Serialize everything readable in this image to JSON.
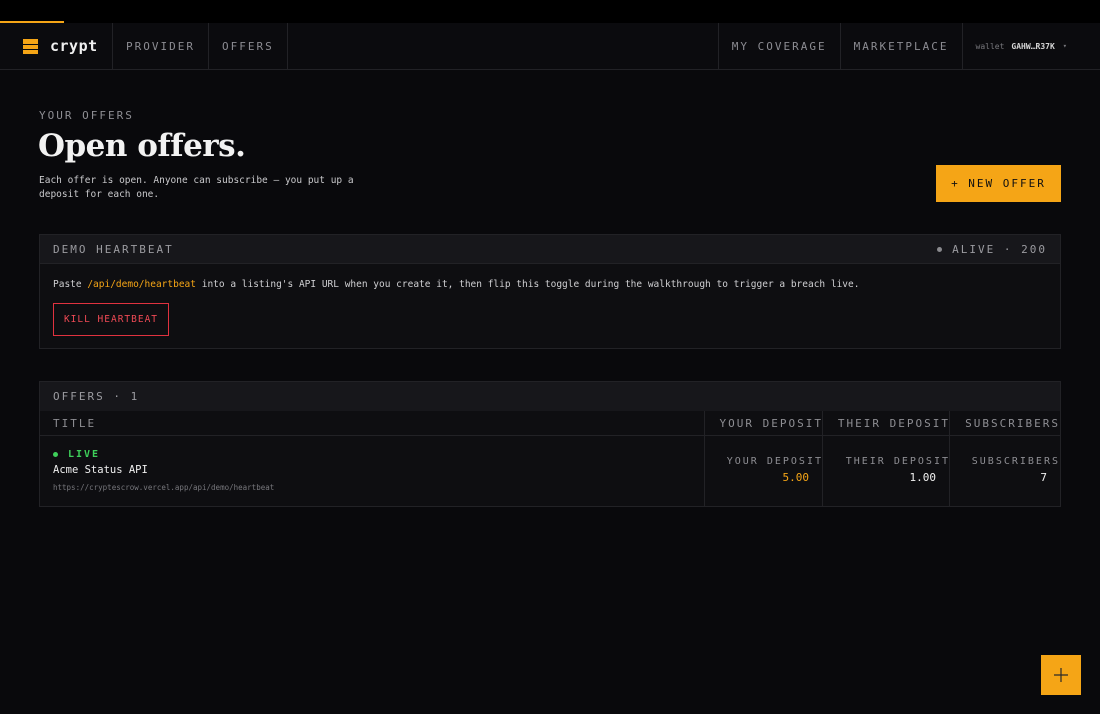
{
  "nav": {
    "brand": "crypt",
    "links_left": [
      "PROVIDER",
      "OFFERS"
    ],
    "links_right": [
      "MY COVERAGE",
      "MARKETPLACE"
    ],
    "wallet_label": "wallet",
    "wallet_address": "GAHW…R37K",
    "wallet_caret": "▾"
  },
  "header": {
    "eyebrow": "YOUR OFFERS",
    "title": "Open offers.",
    "subtitle": "Each offer is open. Anyone can subscribe — you put up a deposit for each one.",
    "new_offer_button": "+ NEW OFFER"
  },
  "heartbeat": {
    "title": "DEMO HEARTBEAT",
    "status": "ALIVE · 200",
    "text_before": "Paste ",
    "path": "/api/demo/heartbeat",
    "text_after": " into a listing's API URL when you create it, then flip this toggle during the walkthrough to trigger a breach live.",
    "kill_button": "KILL HEARTBEAT"
  },
  "offers": {
    "heading": "OFFERS · 1",
    "columns": {
      "title": "TITLE",
      "your_deposit": "YOUR DEPOSIT",
      "their_deposit": "THEIR DEPOSIT",
      "subscribers": "SUBSCRIBERS"
    },
    "rows": [
      {
        "status": "LIVE",
        "title": "Acme Status API",
        "url": "https://cryptescrow.vercel.app/api/demo/heartbeat",
        "your_deposit_label": "YOUR DEPOSIT",
        "your_deposit": "5.00",
        "their_deposit_label": "THEIR DEPOSIT",
        "their_deposit": "1.00",
        "subscribers_label": "SUBSCRIBERS",
        "subscribers": "7"
      }
    ]
  },
  "fab": {
    "icon": "plus-icon"
  },
  "colors": {
    "accent": "#f5a516",
    "live": "#3ecf5a",
    "danger": "#e0323f",
    "background": "#09090c"
  }
}
